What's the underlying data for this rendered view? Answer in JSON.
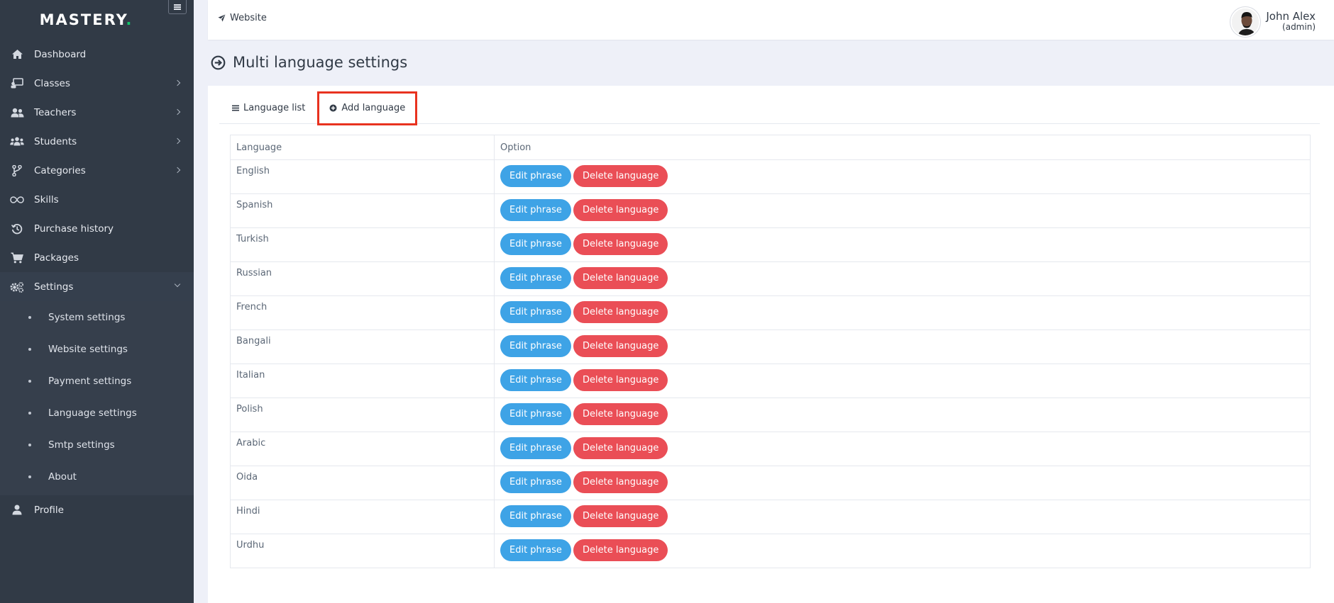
{
  "brand": {
    "name": "MASTERY",
    "dot": "."
  },
  "sidebar": {
    "items": [
      {
        "label": "Dashboard",
        "icon": "home-icon",
        "has_children": false
      },
      {
        "label": "Classes",
        "icon": "classroom-icon",
        "has_children": true
      },
      {
        "label": "Teachers",
        "icon": "users-icon",
        "has_children": true
      },
      {
        "label": "Students",
        "icon": "users-group-icon",
        "has_children": true
      },
      {
        "label": "Categories",
        "icon": "branch-icon",
        "has_children": true
      },
      {
        "label": "Skills",
        "icon": "infinity-icon",
        "has_children": false
      },
      {
        "label": "Purchase history",
        "icon": "history-icon",
        "has_children": false
      },
      {
        "label": "Packages",
        "icon": "cart-icon",
        "has_children": false
      },
      {
        "label": "Settings",
        "icon": "gears-icon",
        "has_children": true,
        "open": true
      }
    ],
    "settings_submenu": [
      "System settings",
      "Website settings",
      "Payment settings",
      "Language settings",
      "Smtp settings",
      "About"
    ],
    "profile": {
      "label": "Profile",
      "icon": "user-icon"
    }
  },
  "topbar": {
    "website_link": "Website",
    "user_name": "John Alex",
    "user_role": "(admin)"
  },
  "page": {
    "title": "Multi language settings"
  },
  "tabs": {
    "list_label": "Language list",
    "add_label": "Add language"
  },
  "table": {
    "headers": [
      "Language",
      "Option"
    ],
    "edit_label": "Edit phrase",
    "delete_label": "Delete language",
    "rows": [
      "English",
      "Spanish",
      "Turkish",
      "Russian",
      "French",
      "Bangali",
      "Italian",
      "Polish",
      "Arabic",
      "Oida",
      "Hindi",
      "Urdhu"
    ]
  },
  "colors": {
    "sidebar_bg": "#313a46",
    "edit_button": "#3ea3e6",
    "delete_button": "#ea4e56",
    "highlight": "#e8321f",
    "brand_dot": "#10c469"
  }
}
